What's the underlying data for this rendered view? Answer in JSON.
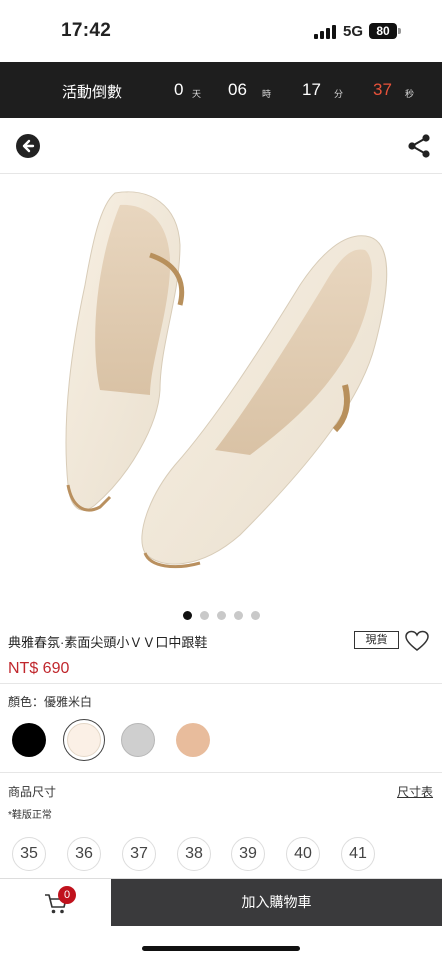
{
  "status_bar": {
    "time": "17:42",
    "network": "5G",
    "battery": "80"
  },
  "countdown": {
    "label": "活動倒數",
    "days": "0",
    "days_unit": "天",
    "hours": "06",
    "hours_unit": "時",
    "minutes": "17",
    "minutes_unit": "分",
    "seconds": "37",
    "seconds_unit": "秒",
    "seconds_color": "#e8523a"
  },
  "nav": {
    "back_icon": "arrow-left-circle-icon",
    "share_icon": "share-icon"
  },
  "gallery": {
    "image": "cream-pointed-toe-pumps",
    "total_images": 5,
    "active_index": 0
  },
  "product": {
    "title": "典雅春氛·素面尖頭小ＶＶ口中跟鞋",
    "stock_badge": "現貨",
    "price": "NT$ 690",
    "price_color": "#c0272d"
  },
  "color": {
    "label": "顏色：優雅米白",
    "options": [
      {
        "name": "black",
        "hex": "#000000",
        "selected": false
      },
      {
        "name": "cream",
        "hex": "#fbf0e6",
        "selected": true
      },
      {
        "name": "grey",
        "hex": "#cfcfcf",
        "selected": false
      },
      {
        "name": "nude",
        "hex": "#e8bc9c",
        "selected": false
      }
    ]
  },
  "size": {
    "label": "商品尺寸",
    "chart_link": "尺寸表",
    "note": "*鞋版正常",
    "options": [
      "35",
      "36",
      "37",
      "38",
      "39",
      "40",
      "41"
    ]
  },
  "bottom_bar": {
    "cart_count": "0",
    "add_to_cart": "加入購物車"
  }
}
